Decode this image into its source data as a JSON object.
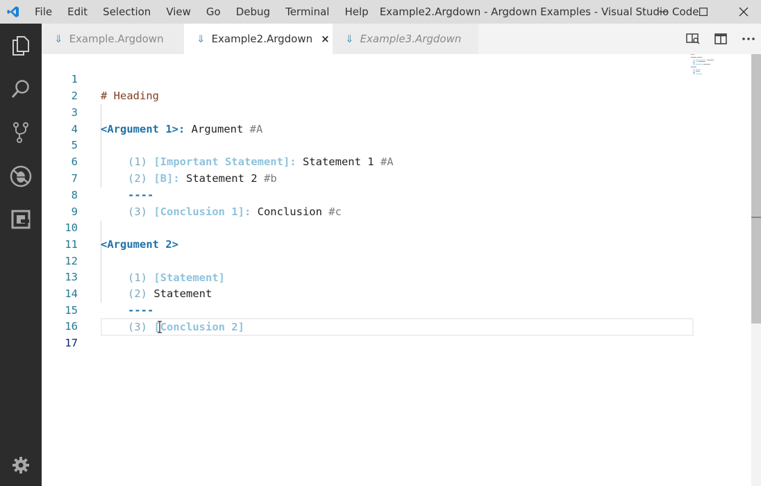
{
  "window": {
    "title": "Example2.Argdown - Argdown Examples - Visual Studio Code",
    "menu": [
      "File",
      "Edit",
      "Selection",
      "View",
      "Go",
      "Debug",
      "Terminal",
      "Help"
    ],
    "controls": [
      "minimize-icon",
      "maximize-icon",
      "close-icon"
    ]
  },
  "activity_bar": {
    "items": [
      "explorer-icon",
      "search-icon",
      "source-control-icon",
      "debug-icon",
      "extensions-icon"
    ],
    "bottom": "settings-gear-icon",
    "background": "#2c2c2c"
  },
  "tabs": [
    {
      "label": "Example.Argdown",
      "state": "inactive",
      "icon": "argdown-arrow-icon"
    },
    {
      "label": "Example2.Argdown",
      "state": "active",
      "icon": "argdown-arrow-icon",
      "close": "×"
    },
    {
      "label": "Example3.Argdown",
      "state": "preview",
      "icon": "argdown-arrow-icon"
    }
  ],
  "editor_actions": [
    "open-preview-icon",
    "split-editor-icon",
    "more-actions-icon"
  ],
  "editor": {
    "line_numbers": [
      "1",
      "2",
      "3",
      "4",
      "5",
      "6",
      "7",
      "8",
      "9",
      "10",
      "11",
      "12",
      "13",
      "14",
      "15",
      "16",
      "17"
    ],
    "current_line": "17",
    "lines": {
      "l1": {
        "heading": "# Heading"
      },
      "l3": {
        "arg": "<Argument 1>:",
        "text": " Argument ",
        "tag": "#A"
      },
      "l5": {
        "num": "(1) ",
        "stmt": "[Important Statement]:",
        "text": " Statement 1 ",
        "tag": "#A"
      },
      "l6": {
        "num": "(2) ",
        "stmt": "[B]:",
        "text": " Statement 2 ",
        "tag": "#b"
      },
      "l7": {
        "sep": "----"
      },
      "l8": {
        "num": "(3) ",
        "stmt": "[Conclusion 1]:",
        "text": " Conclusion ",
        "tag": "#c"
      },
      "l10": {
        "arg": "<Argument 2>"
      },
      "l12": {
        "num": "(1) ",
        "stmt": "[Statement]"
      },
      "l13": {
        "num": "(2) ",
        "text": "Statement"
      },
      "l14": {
        "sep": "----"
      },
      "l15": {
        "num": "(3) ",
        "stmt": "[Conclusion 2]"
      }
    }
  },
  "colors": {
    "argument": "#1f72a8",
    "statement": "#8ec3dd",
    "heading": "#7f3f1f",
    "line_number": "#237893",
    "tag": "#7a7a7a"
  }
}
